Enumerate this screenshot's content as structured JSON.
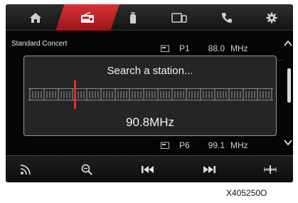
{
  "tabs": [
    {
      "icon": "home-icon",
      "active": false
    },
    {
      "icon": "radio-icon",
      "active": true
    },
    {
      "icon": "media-icon",
      "active": false
    },
    {
      "icon": "device-icon",
      "active": false
    },
    {
      "icon": "phone-icon",
      "active": false
    },
    {
      "icon": "settings-icon",
      "active": false
    }
  ],
  "preset_group_label": "Standard  Concert",
  "presets": [
    {
      "number": "P1",
      "frequency": "88.0",
      "unit": "MHz"
    },
    {
      "number": "P6",
      "frequency": "99.1",
      "unit": "MHz"
    }
  ],
  "search_popup": {
    "title": "Search a station...",
    "frequency": "90.8MHz",
    "scale_marker_fraction": 0.19
  },
  "bottom_buttons": [
    {
      "icon": "radio-waves-icon"
    },
    {
      "icon": "search-scan-icon"
    },
    {
      "icon": "seek-back-icon"
    },
    {
      "icon": "seek-forward-icon"
    },
    {
      "icon": "manual-tune-icon"
    }
  ],
  "colors": {
    "accent": "#c8232b",
    "marker": "#e03030"
  },
  "image_code": "X405250O"
}
